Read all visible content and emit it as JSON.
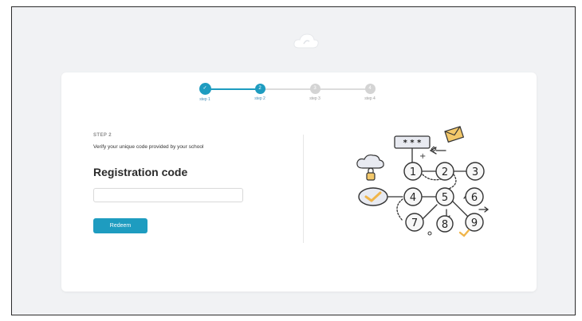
{
  "stepper": {
    "steps": [
      {
        "label": "step 1",
        "marker": "✓",
        "state": "done"
      },
      {
        "label": "step 2",
        "marker": "2",
        "state": "active"
      },
      {
        "label": "step 3",
        "marker": "3",
        "state": "inactive"
      },
      {
        "label": "step 4",
        "marker": "4",
        "state": "inactive"
      }
    ]
  },
  "form": {
    "step_kicker": "STEP 2",
    "subtitle": "Verify your unique code provided by your school",
    "title": "Registration code",
    "code_value": "",
    "redeem_label": "Redeem"
  },
  "illustration": {
    "masked_code": "* * *",
    "numbers": [
      "1",
      "2",
      "3",
      "4",
      "5",
      "6",
      "7",
      "8",
      "9"
    ]
  },
  "colors": {
    "accent": "#1e9cc0",
    "inactive": "#d4d4d4"
  },
  "icons": [
    "cloud-logo-icon",
    "checkmark-icon"
  ]
}
